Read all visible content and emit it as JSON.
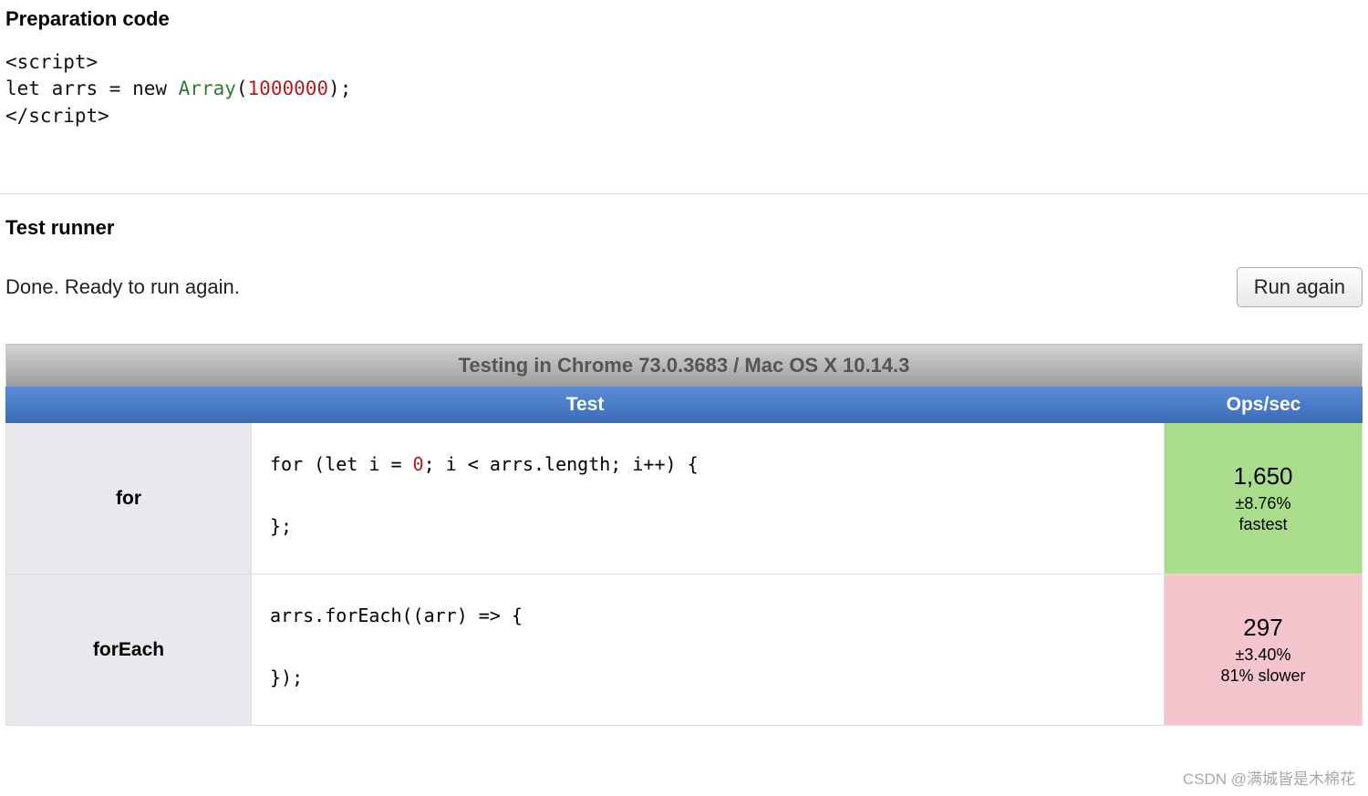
{
  "prep": {
    "title": "Preparation code",
    "code_line1_open": "<script>",
    "code_line2_a": "let arrs = ",
    "code_line2_new": "new ",
    "code_line2_type": "Array",
    "code_line2_paren_open": "(",
    "code_line2_num": "1000000",
    "code_line2_close": ");",
    "code_line3_close": "</scr",
    "code_line3_close_b": "ipt>"
  },
  "runner": {
    "title": "Test runner",
    "status": "Done. Ready to run again.",
    "button": "Run again"
  },
  "table": {
    "banner": "Testing in Chrome 73.0.3683 / Mac OS X 10.14.3",
    "header_test": "Test",
    "header_ops": "Ops/sec",
    "rows": [
      {
        "name": "for",
        "code_a": "for (let i = ",
        "code_zero": "0",
        "code_b": "; i < arrs.length; i++) {\n\n};",
        "ops_value": "1,650",
        "ops_margin": "±8.76%",
        "ops_rank": "fastest",
        "ops_class": "green"
      },
      {
        "name": "forEach",
        "code_full": "arrs.forEach((arr) => {\n\n});",
        "ops_value": "297",
        "ops_margin": "±3.40%",
        "ops_rank": "81% slower",
        "ops_class": "pink"
      }
    ]
  },
  "footer": {
    "credit": "CSDN @满城皆是木棉花"
  }
}
